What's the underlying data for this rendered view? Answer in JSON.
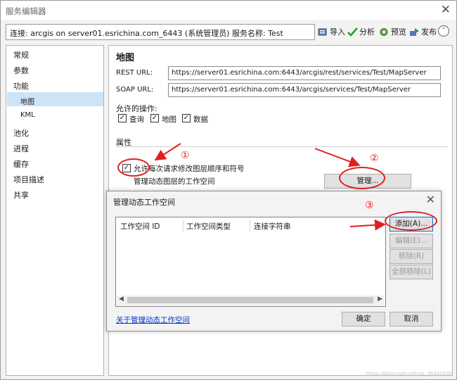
{
  "window": {
    "title": "服务编辑器",
    "close": "✕"
  },
  "toolbar": {
    "connection": "连接: arcgis on server01.esrichina.com_6443 (系统管理员)   服务名称: Test",
    "import_label": "导入",
    "analyze_label": "分析",
    "preview_label": "预览",
    "publish_label": "发布",
    "collapse_symbol": "˄"
  },
  "sidebar": {
    "items": [
      {
        "label": "常规"
      },
      {
        "label": "参数"
      },
      {
        "label": "功能"
      },
      {
        "label": "地图"
      },
      {
        "label": "KML"
      },
      {
        "label": "池化"
      },
      {
        "label": "进程"
      },
      {
        "label": "缓存"
      },
      {
        "label": "项目描述"
      },
      {
        "label": "共享"
      }
    ],
    "selected": "地图"
  },
  "main": {
    "title": "地图",
    "rest_label": "REST URL:",
    "rest_url": "https://server01.esrichina.com:6443/arcgis/rest/services/Test/MapServer",
    "soap_label": "SOAP URL:",
    "soap_url": "https://server01.esrichina.com:6443/arcgis/services/Test/MapServer",
    "ops_label": "允许的操作:",
    "ops": [
      {
        "label": "查询",
        "checked": true
      },
      {
        "label": "地图",
        "checked": true
      },
      {
        "label": "数据",
        "checked": true
      }
    ],
    "props_label": "属性",
    "allow_change_label": "允许每次请求修改图层顺序和符号",
    "allow_change_checked": true,
    "manage_ws_label": "管理动态图层的工作空间",
    "manage_button": "管理..."
  },
  "dialog": {
    "title": "管理动态工作空间",
    "close": "✕",
    "columns": [
      "工作空间 ID",
      "工作空间类型",
      "连接字符串"
    ],
    "buttons": {
      "add": "添加(A)...",
      "edit": "编辑(E)...",
      "remove": "移除(R)",
      "remove_all": "全部移除(L)",
      "ok": "确定",
      "cancel": "取消"
    },
    "help_link": "关于管理动态工作空间"
  },
  "annotations": {
    "step1": "①",
    "step2": "②",
    "step3": "③"
  },
  "watermark": "https://blog.csdn.net/qq_36363630",
  "colors": {
    "annotation": "#e02020",
    "selection": "#cce4f7",
    "link": "#0033cc"
  }
}
